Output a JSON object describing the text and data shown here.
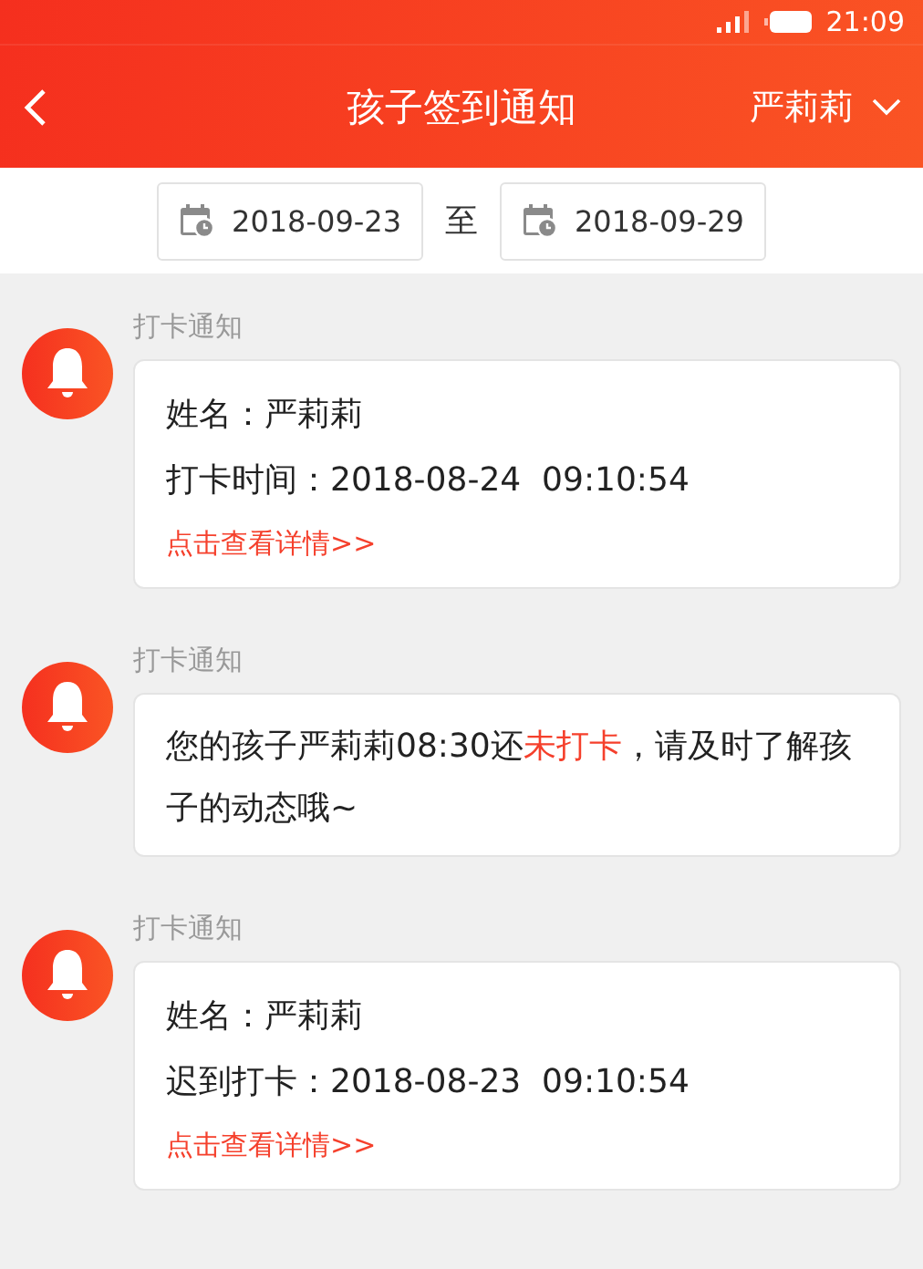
{
  "status_bar": {
    "time": "21:09"
  },
  "header": {
    "title": "孩子签到通知",
    "child_selector": "严莉莉"
  },
  "date_range": {
    "start": "2018-09-23",
    "separator": "至",
    "end": "2018-09-29"
  },
  "notifications": [
    {
      "kind": "detail",
      "label": "打卡通知",
      "lines": [
        "姓名：严莉莉",
        "打卡时间：2018-08-24  09:10:54"
      ],
      "link": "点击查看详情>>"
    },
    {
      "kind": "message",
      "label": "打卡通知",
      "segments": [
        {
          "text": "您的孩子严莉莉08:30还",
          "highlight": false
        },
        {
          "text": "未打卡",
          "highlight": true
        },
        {
          "text": "，请及时了解孩子的动态哦~",
          "highlight": false
        }
      ]
    },
    {
      "kind": "detail",
      "label": "打卡通知",
      "lines": [
        "姓名：严莉莉",
        "迟到打卡：2018-08-23  09:10:54"
      ],
      "link": "点击查看详情>>"
    }
  ]
}
